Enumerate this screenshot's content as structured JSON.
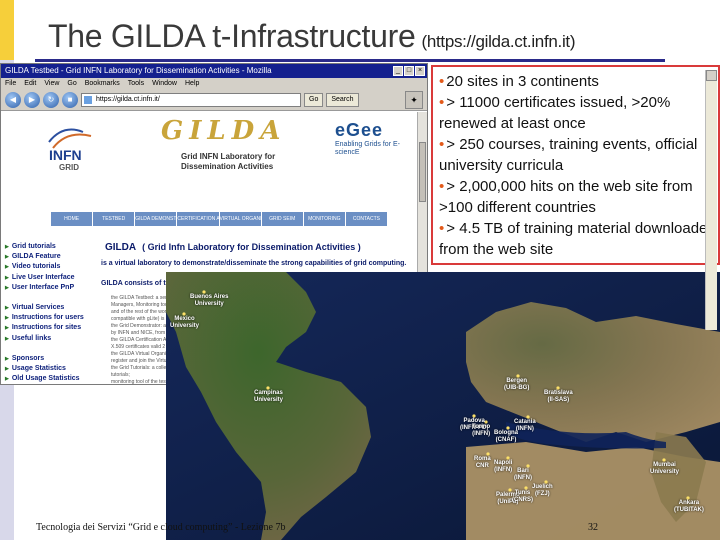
{
  "slide": {
    "title": "The GILDA t-Infrastructure",
    "url": "(https://gilda.ct.infn.it)",
    "footer": "Tecnologia dei Servizi “Grid e cloud computing” - Lezione 7b",
    "page_number": "32"
  },
  "browser": {
    "window_title": "GILDA Testbed - Grid INFN Laboratory for Dissemination Activities - Mozilla",
    "menu": [
      "File",
      "Edit",
      "View",
      "Go",
      "Bookmarks",
      "Tools",
      "Window",
      "Help"
    ],
    "address": "https://gilda.ct.infn.it/",
    "go_label": "Go",
    "search_label": "Search",
    "infn_label": "INFN",
    "grid_label": "GRID",
    "gilda_logo": "GILDA",
    "gilda_subtitle": "Grid INFN Laboratory for Dissemination Activities",
    "egee_name": "eGee",
    "egee_tagline": "Enabling Grids for E-sciencE",
    "tabs": [
      "HOME",
      "TESTBED",
      "GILDA DEMONSTRATOR",
      "CERTIFICATION AUTHORITY",
      "VIRTUAL ORGANIZATION",
      "GRID SEIM",
      "MONITORING",
      "CONTACTS"
    ],
    "nav": {
      "group1": [
        "Grid tutorials",
        "GILDA Feature",
        "Video tutorials",
        "Live User Interface",
        "User Interface PnP"
      ],
      "group2": [
        "Virtual Services",
        "Instructions for users",
        "Instructions for sites",
        "Useful links"
      ],
      "group3": [
        "Sponsors",
        "Usage Statistics",
        "Old Usage Statistics"
      ]
    },
    "headline_word": "GILDA",
    "headline": "( Grid Infn Laboratory for Dissemination Activities )",
    "description": "is a virtual laboratory to demonstrate/disseminate the strong capabilities of grid computing.",
    "consists": "GILDA consists of the following elements:",
    "body_lines": [
      "the GILDA Testbed: a series of sites and services (Resource Broker, Information Index, Data",
      "Managers, Monitoring tool, Computing Elements, and Storage Elements) spread all over Italy",
      "and of the rest of the world on which the latest version of the INFN Grid middleware (fully",
      "compatible with gLite) is installed; the middleware stack is maintained up-to-date;",
      "the Grid Demonstrator: a customized version of the full GENIUS web portal, jointly developed",
      "by INFN and NICE, from where everyone can try to submit jobs on the Grid;",
      "the GILDA Certification Authority: a fully featured CA which issues",
      "X.509 certificates valid 2 weeks;",
      "the GILDA Virtual Organization: a VO to which all users can",
      "register and join the Virtual Organization;",
      "the Grid Tutorials: a collection of material of the",
      "tutorials;",
      "monitoring tool of the testbed;",
      "the GILDA Monitor"
    ]
  },
  "info_box": {
    "bullets": [
      "20 sites in 3 continents",
      "> 11000 certificates issued,  >20% renewed at least once",
      "> 250 courses, training events, official university curricula",
      "> 2,000,000 hits on the web site from >100 different countries",
      "> 4.5 TB of training material downloaded from the web site"
    ]
  },
  "map_labels": [
    {
      "id": "buenos-aires",
      "text": "Buenos Aires\nUniversity"
    },
    {
      "id": "mexico",
      "text": "Mexico\nUniversity"
    },
    {
      "id": "campinas",
      "text": "Campinas\nUniversity"
    },
    {
      "id": "bergen",
      "text": "Bergen\n(UIB-BG)"
    },
    {
      "id": "bratislava",
      "text": "Bratislava\n(II-SAS)"
    },
    {
      "id": "padova",
      "text": "Padova\n(INFN-PD)"
    },
    {
      "id": "torino",
      "text": "Torino\n(INFN)"
    },
    {
      "id": "bologna",
      "text": "Bologna\n(CNAF)"
    },
    {
      "id": "catania",
      "text": "Catania\n(INFN)"
    },
    {
      "id": "roma",
      "text": "Roma\nCNR"
    },
    {
      "id": "napoli",
      "text": "Napoli\n(INFN)"
    },
    {
      "id": "bari",
      "text": "Bari\n(INFN)"
    },
    {
      "id": "palermo",
      "text": "Palermo\n(UniPa)"
    },
    {
      "id": "tunis",
      "text": "Tunis\n(CNRS)"
    },
    {
      "id": "juelich",
      "text": "Juelich\n(FZJ)"
    },
    {
      "id": "mumbai",
      "text": "Mumbai\nUniversity"
    },
    {
      "id": "ankara",
      "text": "Ankara\n(TUBITAK)"
    }
  ],
  "colors": {
    "title_rule": "#2a2a8a",
    "info_border": "#d93a3a",
    "bullet": "#e35a1a",
    "browser_titlebar": "#14208e"
  }
}
